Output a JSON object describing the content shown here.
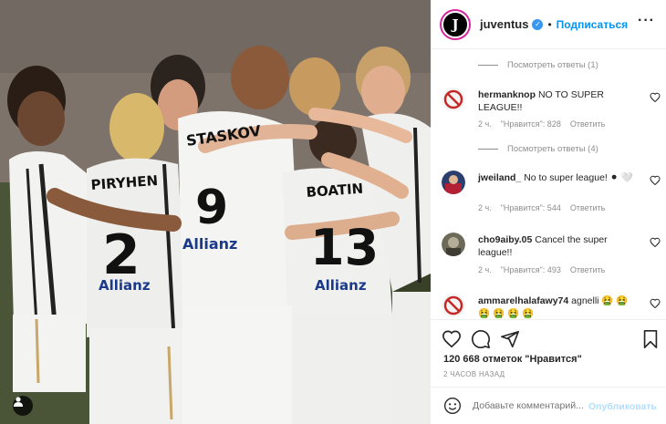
{
  "header": {
    "username": "juventus",
    "verified_mark": "✓",
    "separator": "•",
    "follow_label": "Подписаться",
    "more_label": "···",
    "avatar_letter": "J"
  },
  "photo": {
    "jersey_names": [
      "STASKOV",
      "PIRYHEN",
      "BOATIN"
    ],
    "jersey_numbers": [
      "9",
      "2",
      "13"
    ],
    "sponsor": "Allianz"
  },
  "comments": {
    "replies_1": "Посмотреть ответы (1)",
    "replies_2": "Посмотреть ответы (4)",
    "items": [
      {
        "username": "hermanknop",
        "text": "NO TO SUPER LEAGUE!!",
        "time": "2 ч.",
        "likes": "\"Нравится\": 828",
        "reply": "Ответить"
      },
      {
        "username": "jweiland_",
        "text": "No to super league! ⚫ 🤍",
        "time": "2 ч.",
        "likes": "\"Нравится\": 544",
        "reply": "Ответить"
      },
      {
        "username": "cho9aiby.05",
        "text": "Cancel the super league!!",
        "time": "2 ч.",
        "likes": "\"Нравится\": 493",
        "reply": "Ответить"
      },
      {
        "username": "ammarelhalafawy74",
        "text": "agnelli 🤮 🤮 🤮 🤮 🤮 🤮"
      }
    ]
  },
  "stats": {
    "likes_text": "120 668 отметок \"Нравится\"",
    "time_ago": "2 ЧАСОВ НАЗАД"
  },
  "add_comment": {
    "placeholder": "Добавьте комментарий...",
    "publish_label": "Опубликовать"
  },
  "colors": {
    "accent": "#0095f6",
    "verified": "#3897f0",
    "muted": "#8e8e8e"
  }
}
